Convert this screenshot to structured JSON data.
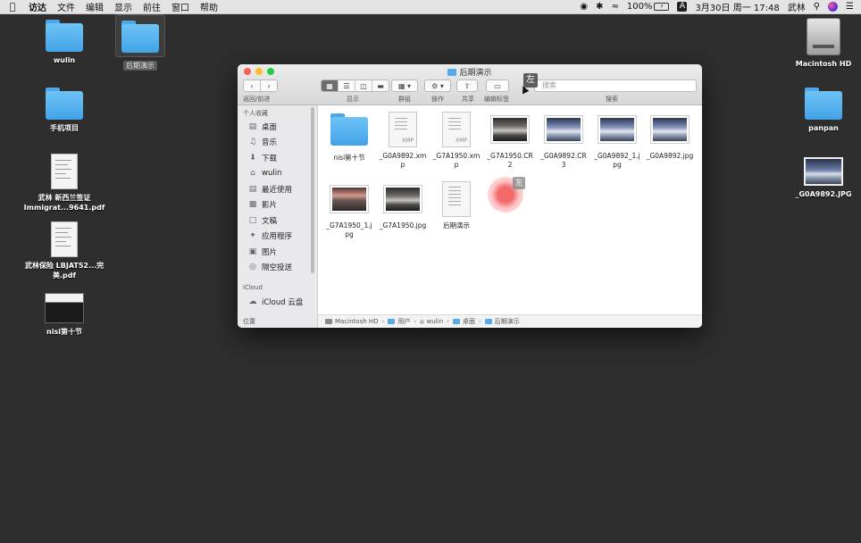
{
  "menubar": {
    "items": [
      "访达",
      "文件",
      "编辑",
      "显示",
      "前往",
      "窗口",
      "帮助"
    ],
    "battery": "100%",
    "input_method": "A",
    "datetime": "3月30日 周一  17:48",
    "user": "武林"
  },
  "desktop_icons": {
    "wulin": "wulin",
    "houqi": "后期演示",
    "shouji": "手机项目",
    "pdf1": "武林 新西兰签证 Immigrat...9641.pdf",
    "pdf2": "武林保险 LBJAT52...完美.pdf",
    "nisi": "nisi第十节",
    "mac_hd": "Macintosh HD",
    "panpan": "panpan",
    "jpg": "_G0A9892.JPG"
  },
  "window": {
    "title": "后期演示",
    "nav_label": "返回/前进",
    "toolbar_labels": [
      "显示",
      "群组",
      "操作",
      "共享",
      "编辑标签",
      "搜索"
    ],
    "search_placeholder": "搜索",
    "tooltip": "左"
  },
  "sidebar": {
    "favorites_header": "个人收藏",
    "items": [
      "桌面",
      "音乐",
      "下载",
      "wulin",
      "最近使用",
      "影片",
      "文稿",
      "应用程序",
      "图片",
      "隔空投送"
    ],
    "icloud_header": "iCloud",
    "icloud_items": [
      "iCloud 云盘"
    ],
    "locations_header": "位置"
  },
  "files": [
    "nisi第十节",
    "_G0A9892.xmp",
    "_G7A1950.xmp",
    "_G7A1950.CR2",
    "_G0A9892.CR3",
    "_G0A9892_1.jpg",
    "_G0A9892.jpg",
    "_G7A1950_1.jpg",
    "_G7A1950.jpg",
    "后期演示"
  ],
  "drag_tag": "左",
  "pathbar": [
    "Macintosh HD",
    "用户",
    "wulin",
    "桌面",
    "后期演示"
  ]
}
